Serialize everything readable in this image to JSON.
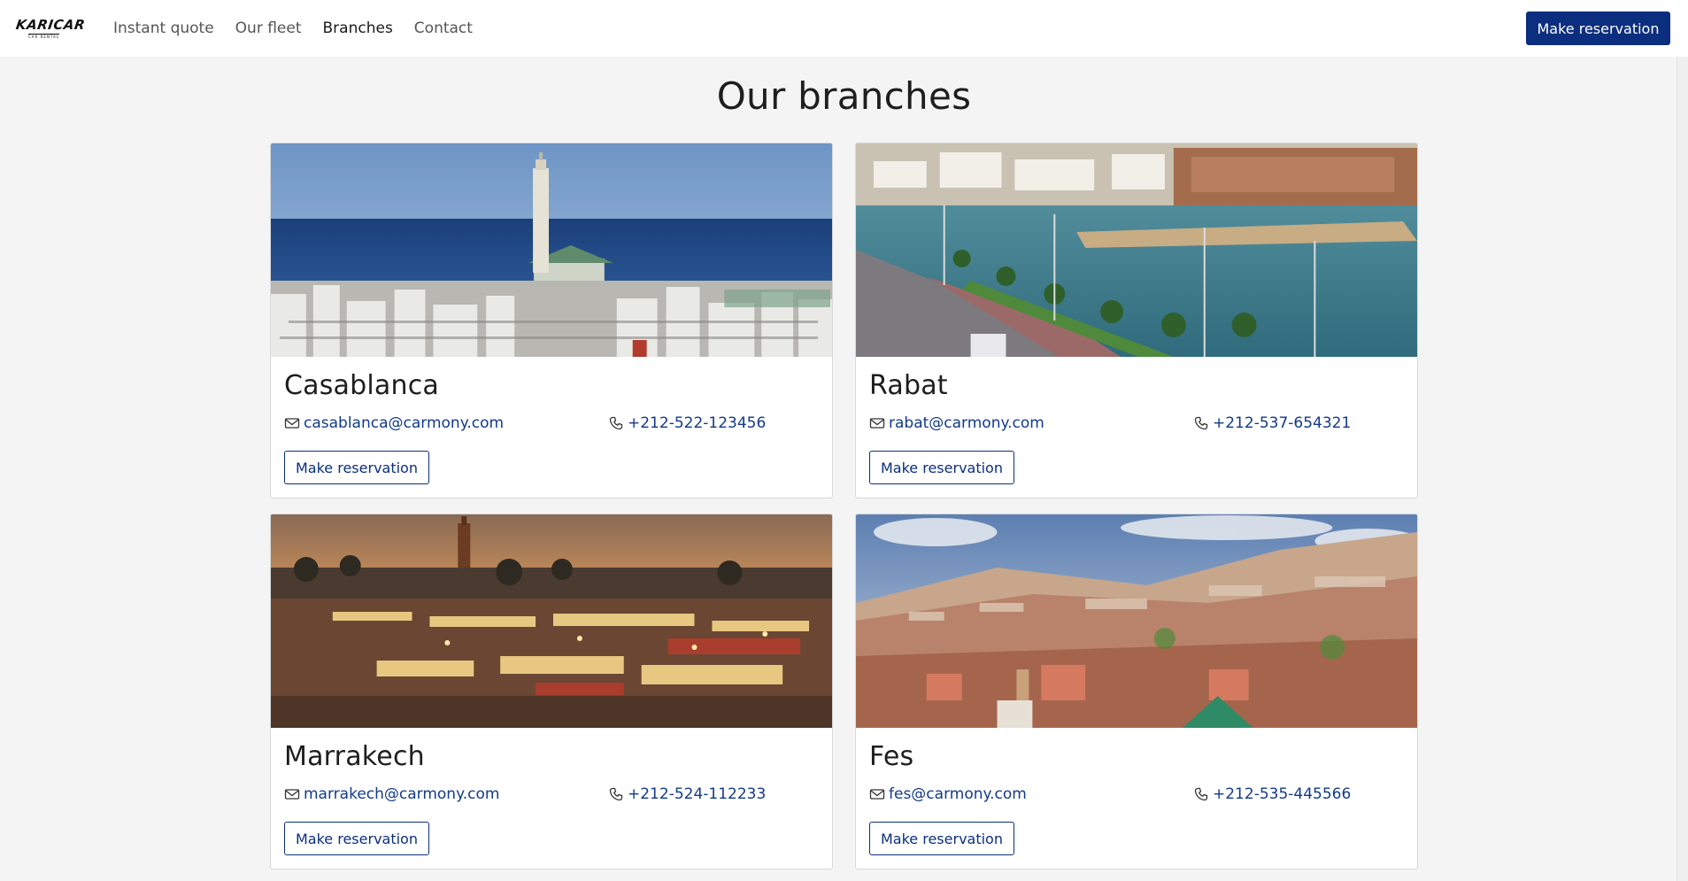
{
  "header": {
    "logo_text": "KARICAR",
    "logo_subtext": "CAR RENTAL",
    "nav": [
      {
        "label": "Instant quote"
      },
      {
        "label": "Our fleet"
      },
      {
        "label": "Branches"
      },
      {
        "label": "Contact"
      }
    ],
    "active_nav": "Branches",
    "cta_label": "Make reservation"
  },
  "page": {
    "title": "Our branches"
  },
  "branches": [
    {
      "name": "Casablanca",
      "email": "casablanca@carmony.com",
      "phone": "+212-522-123456",
      "button_label": "Make reservation",
      "image": "Casablanca skyline with Hassan II mosque and sea"
    },
    {
      "name": "Rabat",
      "email": "rabat@carmony.com",
      "phone": "+212-537-654321",
      "button_label": "Make reservation",
      "image": "Rabat riverside promenade with kasbah walls"
    },
    {
      "name": "Marrakech",
      "email": "marrakech@carmony.com",
      "phone": "+212-524-112233",
      "button_label": "Make reservation",
      "image": "Marrakech Jemaa el-Fnaa square at sunset"
    },
    {
      "name": "Fes",
      "email": "fes@carmony.com",
      "phone": "+212-535-445566",
      "button_label": "Make reservation",
      "image": "Fes medina panorama"
    }
  ],
  "colors": {
    "brand": "#0b2e7e",
    "link": "#123a8a",
    "background": "#f4f4f4",
    "card_border": "#d8d8d8"
  },
  "icons": {
    "email": "envelope-icon",
    "phone": "phone-icon"
  }
}
